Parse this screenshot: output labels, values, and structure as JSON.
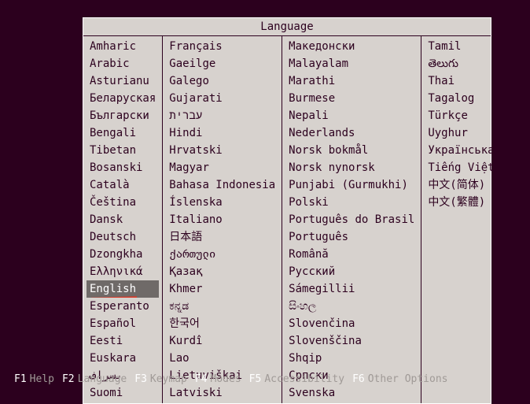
{
  "window": {
    "title": "Language"
  },
  "selected": "English",
  "annotated": "English",
  "columns": [
    [
      "Amharic",
      "Arabic",
      "Asturianu",
      "Беларуская",
      "Български",
      "Bengali",
      "Tibetan",
      "Bosanski",
      "Català",
      "Čeština",
      "Dansk",
      "Deutsch",
      "Dzongkha",
      "Ελληνικά",
      "English",
      "Esperanto",
      "Español",
      "Eesti",
      "Euskara",
      "ىسراف",
      "Suomi"
    ],
    [
      "Français",
      "Gaeilge",
      "Galego",
      "Gujarati",
      "עברית",
      "Hindi",
      "Hrvatski",
      "Magyar",
      "Bahasa Indonesia",
      "Íslenska",
      "Italiano",
      "日本語",
      "ქართული",
      "Қазақ",
      "Khmer",
      "ಕನ್ನಡ",
      "한국어",
      "Kurdî",
      "Lao",
      "Lietuviškai",
      "Latviski"
    ],
    [
      "Македонски",
      "Malayalam",
      "Marathi",
      "Burmese",
      "Nepali",
      "Nederlands",
      "Norsk bokmål",
      "Norsk nynorsk",
      "Punjabi (Gurmukhi)",
      "Polski",
      "Português do Brasil",
      "Português",
      "Română",
      "Русский",
      "Sámegillii",
      "සිංහල",
      "Slovenčina",
      "Slovenščina",
      "Shqip",
      "Српски",
      "Svenska"
    ],
    [
      "Tamil",
      "తెలుగు",
      "Thai",
      "Tagalog",
      "Türkçe",
      "Uyghur",
      "Українська",
      "Tiếng Việt",
      "中文(简体)",
      "中文(繁體)"
    ]
  ],
  "footer": [
    {
      "key": "F1",
      "label": "Help"
    },
    {
      "key": "F2",
      "label": "Language"
    },
    {
      "key": "F3",
      "label": "Keymap"
    },
    {
      "key": "F4",
      "label": "Modes"
    },
    {
      "key": "F5",
      "label": "Accessibility"
    },
    {
      "key": "F6",
      "label": "Other Options"
    }
  ]
}
